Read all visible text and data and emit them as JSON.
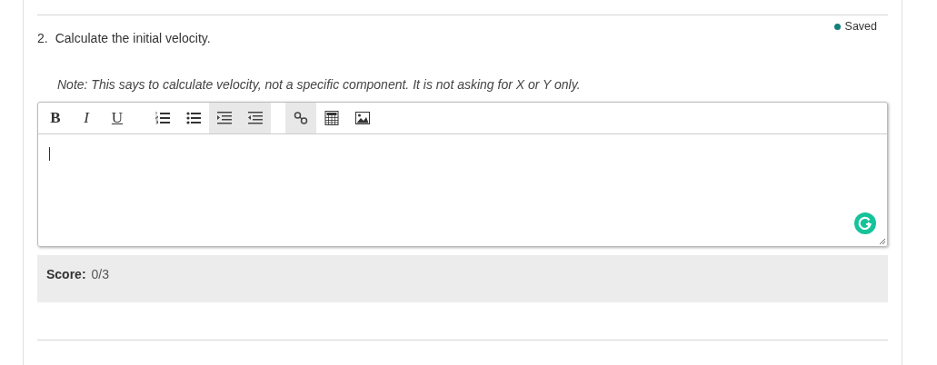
{
  "status": {
    "label": "Saved"
  },
  "question": {
    "number": "2.",
    "text": "Calculate the initial velocity.",
    "note": "Note: This says to calculate velocity, not a specific component. It is not asking for X or Y only."
  },
  "toolbar": {
    "groups": [
      [
        {
          "kind": "bold",
          "label": "B",
          "disabled": false
        },
        {
          "kind": "italic",
          "label": "I",
          "disabled": false
        },
        {
          "kind": "underline",
          "label": "U",
          "disabled": false
        }
      ],
      [
        {
          "kind": "ordered-list",
          "disabled": false
        },
        {
          "kind": "bullet-list",
          "disabled": false
        },
        {
          "kind": "indent",
          "disabled": true
        },
        {
          "kind": "outdent",
          "disabled": true
        }
      ],
      [
        {
          "kind": "link",
          "disabled": true
        },
        {
          "kind": "calculator",
          "disabled": false
        },
        {
          "kind": "image",
          "disabled": false
        }
      ]
    ]
  },
  "score": {
    "label": "Score:",
    "value": "0/3"
  }
}
